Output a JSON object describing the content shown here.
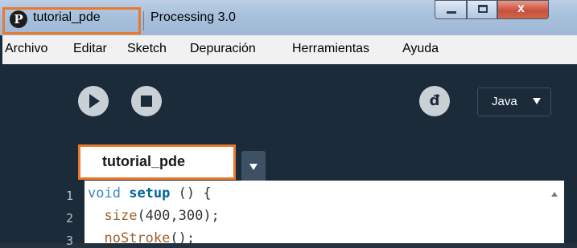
{
  "window": {
    "project_title": "tutorial_pde",
    "app_title": "Processing 3.0",
    "icon_glyph": "P",
    "close_glyph": "x"
  },
  "menu": {
    "items": [
      "Archivo",
      "Editar",
      "Sketch",
      "Depuración",
      "Herramientas",
      "Ayuda"
    ]
  },
  "toolbar": {
    "debug_glyph": "đ",
    "mode": "Java"
  },
  "tabs": [
    {
      "label": "tutorial_pde",
      "active": true
    }
  ],
  "editor": {
    "line_numbers": [
      "1",
      "2",
      "3"
    ],
    "lines": [
      {
        "type": "void",
        "fn": "setup",
        "rest": " () {"
      },
      {
        "indent": "  ",
        "builtin": "size",
        "rest": "(400,300);"
      },
      {
        "indent": "  ",
        "builtin": "noStroke",
        "rest": "();"
      }
    ]
  },
  "colors": {
    "background": "#1b2b3a",
    "highlight": "#e8792f",
    "title_bar": "#a7c0dc",
    "menu_bar": "#f1f1f1"
  }
}
